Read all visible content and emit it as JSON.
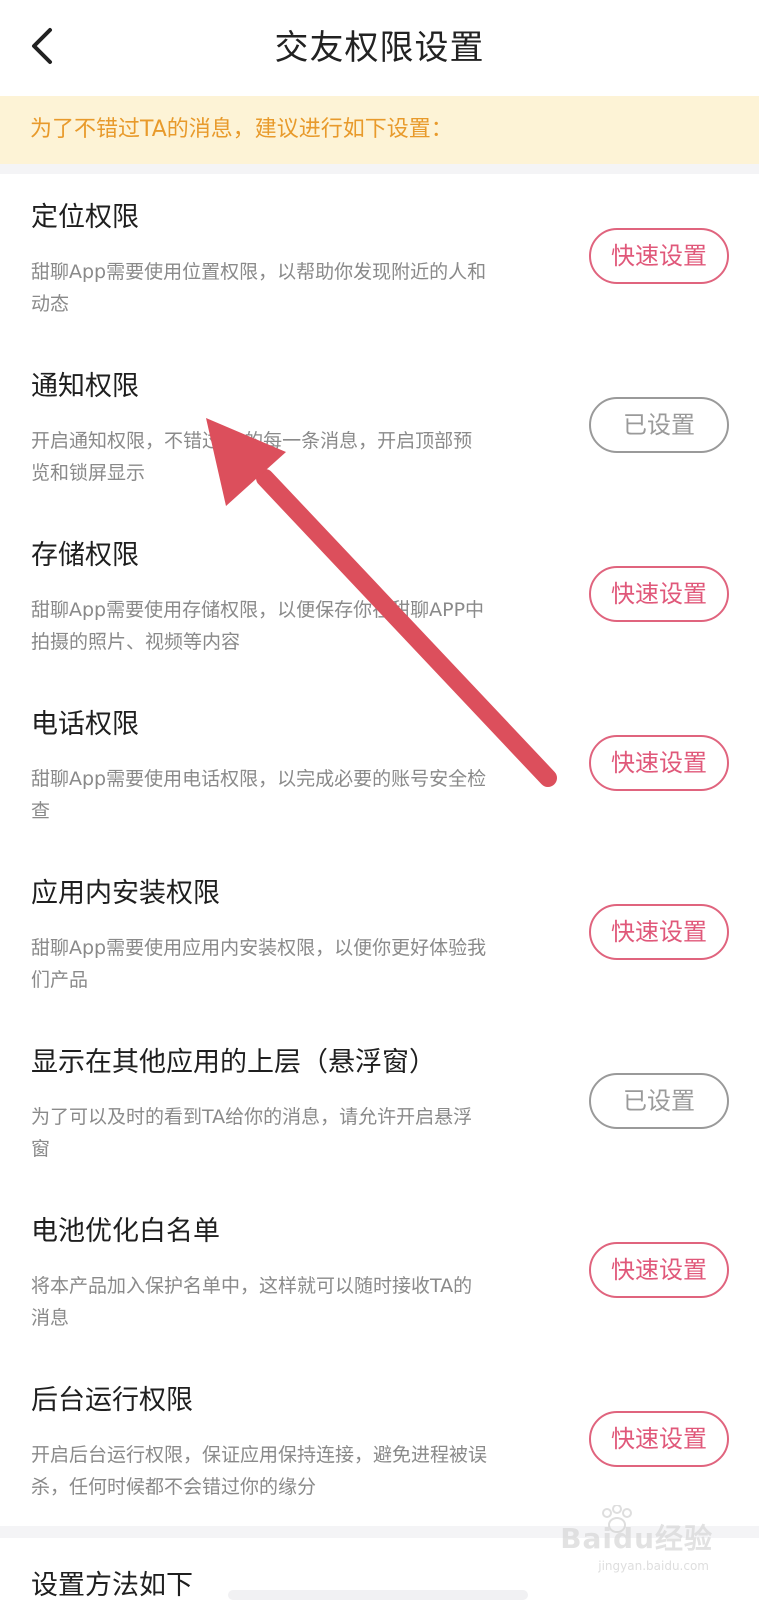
{
  "header": {
    "title": "交友权限设置",
    "back_icon": "chevron-left-icon"
  },
  "notice": {
    "text": "为了不错过TA的消息，建议进行如下设置："
  },
  "permissions": [
    {
      "title": "定位权限",
      "desc": "甜聊App需要使用位置权限，以帮助你发现附近的人和动态",
      "button": "快速设置",
      "status": "pending"
    },
    {
      "title": "通知权限",
      "desc": "开启通知权限，不错过TA的每一条消息，开启顶部预览和锁屏显示",
      "button": "已设置",
      "status": "done"
    },
    {
      "title": "存储权限",
      "desc": "甜聊App需要使用存储权限，以便保存你在甜聊APP中拍摄的照片、视频等内容",
      "button": "快速设置",
      "status": "pending"
    },
    {
      "title": "电话权限",
      "desc": "甜聊App需要使用电话权限，以完成必要的账号安全检查",
      "button": "快速设置",
      "status": "pending"
    },
    {
      "title": "应用内安装权限",
      "desc": "甜聊App需要使用应用内安装权限，以便你更好体验我们产品",
      "button": "快速设置",
      "status": "pending"
    },
    {
      "title": "显示在其他应用的上层（悬浮窗）",
      "desc": "为了可以及时的看到TA给你的消息，请允许开启悬浮窗",
      "button": "已设置",
      "status": "done"
    },
    {
      "title": "电池优化白名单",
      "desc": "将本产品加入保护名单中，这样就可以随时接收TA的消息",
      "button": "快速设置",
      "status": "pending"
    },
    {
      "title": "后台运行权限",
      "desc": "开启后台运行权限，保证应用保持连接，避免进程被误杀，任何时候都不会错过你的缘分",
      "button": "快速设置",
      "status": "pending"
    }
  ],
  "footer": {
    "section_title": "设置方法如下"
  },
  "watermark": {
    "main": "Baidu经验",
    "sub": "jingyan.baidu.com"
  },
  "colors": {
    "accent": "#e0587a",
    "done": "#9a9a9a",
    "notice_bg": "#fdf3d6",
    "notice_text": "#e89a2b",
    "annotation_arrow": "#dc4f5c"
  }
}
